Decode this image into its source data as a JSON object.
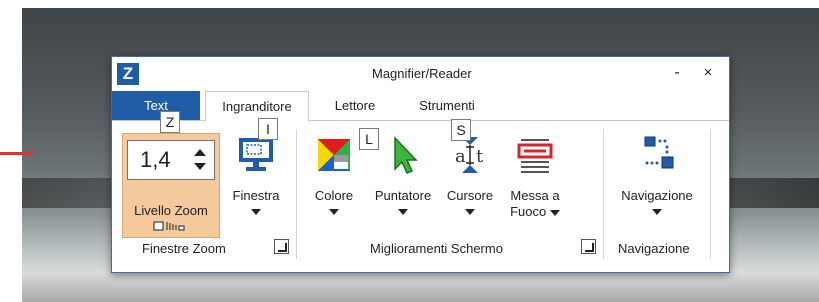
{
  "window": {
    "title": "Magnifier/Reader",
    "logo": "Z",
    "minimize_symbol": "-",
    "close_symbol": "×"
  },
  "tabs": {
    "text": "Text",
    "ingranditore": "Ingranditore",
    "lettore": "Lettore",
    "strumenti": "Strumenti"
  },
  "keytips": {
    "z": "Z",
    "i": "I",
    "l": "L",
    "s": "S"
  },
  "zoom": {
    "value": "1,4",
    "label": "Livello Zoom"
  },
  "buttons": {
    "finestra": "Finestra",
    "colore": "Colore",
    "puntatore": "Puntatore",
    "cursore": "Cursore",
    "messa_line1": "Messa a",
    "messa_line2": "Fuoco",
    "navigazione": "Navigazione"
  },
  "groups": {
    "finestre_zoom": "Finestre Zoom",
    "miglioramenti": "Miglioramenti Schermo",
    "navigazione": "Navigazione"
  },
  "colors": {
    "brand_blue": "#1f5da8",
    "zoom_highlight": "#f4c99b",
    "accent_red": "#e03030"
  },
  "icons": {
    "finestra": "monitor-window-icon",
    "colore": "color-squares-icon",
    "puntatore": "pointer-arrow-icon",
    "cursore": "text-cursor-icon",
    "messa_a_fuoco": "focus-lines-icon",
    "navigazione": "navigation-icon"
  }
}
